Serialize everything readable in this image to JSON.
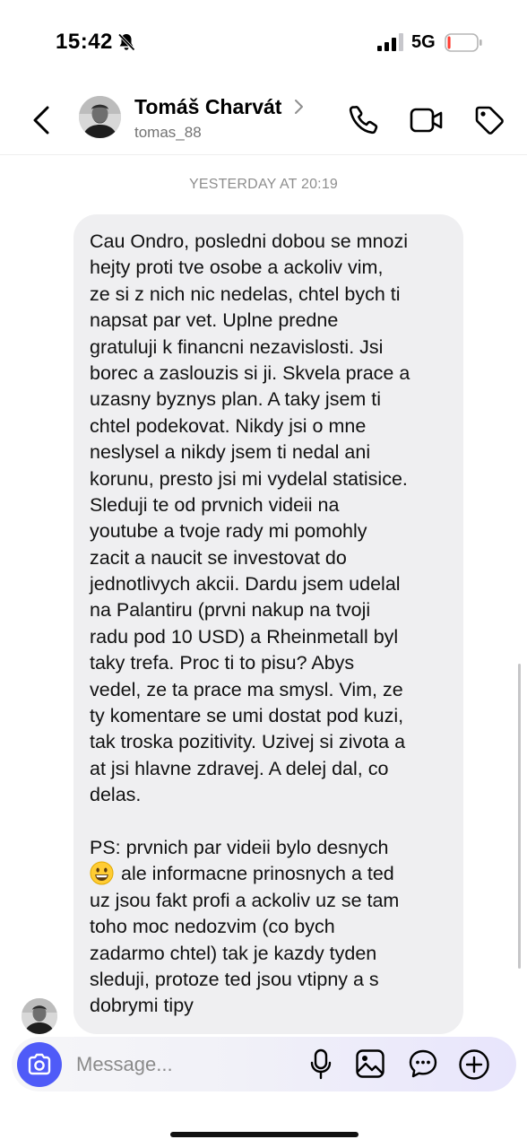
{
  "status_bar": {
    "time": "15:42",
    "network": "5G",
    "battery_level": 0.1,
    "battery_color": "#ff3b30"
  },
  "header": {
    "contact_name": "Tomáš Charvát",
    "username": "tomas_88"
  },
  "chat": {
    "timestamp": "YESTERDAY AT 20:19",
    "lines": [
      "Cau Ondro, posledni dobou se mnozi",
      "hejty proti tve osobe a ackoliv vim,",
      "ze si z nich nic nedelas, chtel bych ti",
      "napsat par vet. Uplne predne",
      "gratuluji k financni nezavislosti. Jsi",
      "borec a zaslouzis si ji. Skvela prace a",
      "uzasny byznys plan. A taky jsem ti",
      "chtel podekovat. Nikdy jsi o mne",
      "neslysel a nikdy jsem ti nedal ani",
      "korunu, presto jsi mi vydelal statisice.",
      "Sleduji te od prvnich videii na",
      "youtube a tvoje rady mi pomohly",
      "zacit a naucit se investovat do",
      "jednotlivych akcii. Dardu jsem udelal",
      "na Palantiru (prvni nakup na tvoji",
      "radu pod 10 USD) a Rheinmetall byl",
      "taky trefa. Proc ti to pisu? Abys",
      "vedel, ze ta prace ma smysl. Vim, ze",
      "ty komentare se umi dostat pod kuzi,",
      "tak troska pozitivity. Uzivej si zivota a",
      "at jsi hlavne zdravej. A delej dal, co",
      "delas."
    ],
    "ps_lines": [
      "PS: prvnich par videii bylo desnych",
      "ale informacne prinosnych a ted",
      "uz jsou fakt profi a ackoliv uz se tam",
      "toho moc nedozvim (co bych",
      "zadarmo chtel) tak je kazdy tyden",
      "sleduji, protoze ted jsou vtipny a s",
      "dobrymi tipy"
    ],
    "emoji_icon": "grinning-face-emoji"
  },
  "composer": {
    "placeholder": "Message...",
    "accent_color": "#4f5bf8",
    "icons": [
      "camera-icon",
      "mic-icon",
      "gallery-icon",
      "sticker-icon",
      "plus-icon"
    ]
  }
}
